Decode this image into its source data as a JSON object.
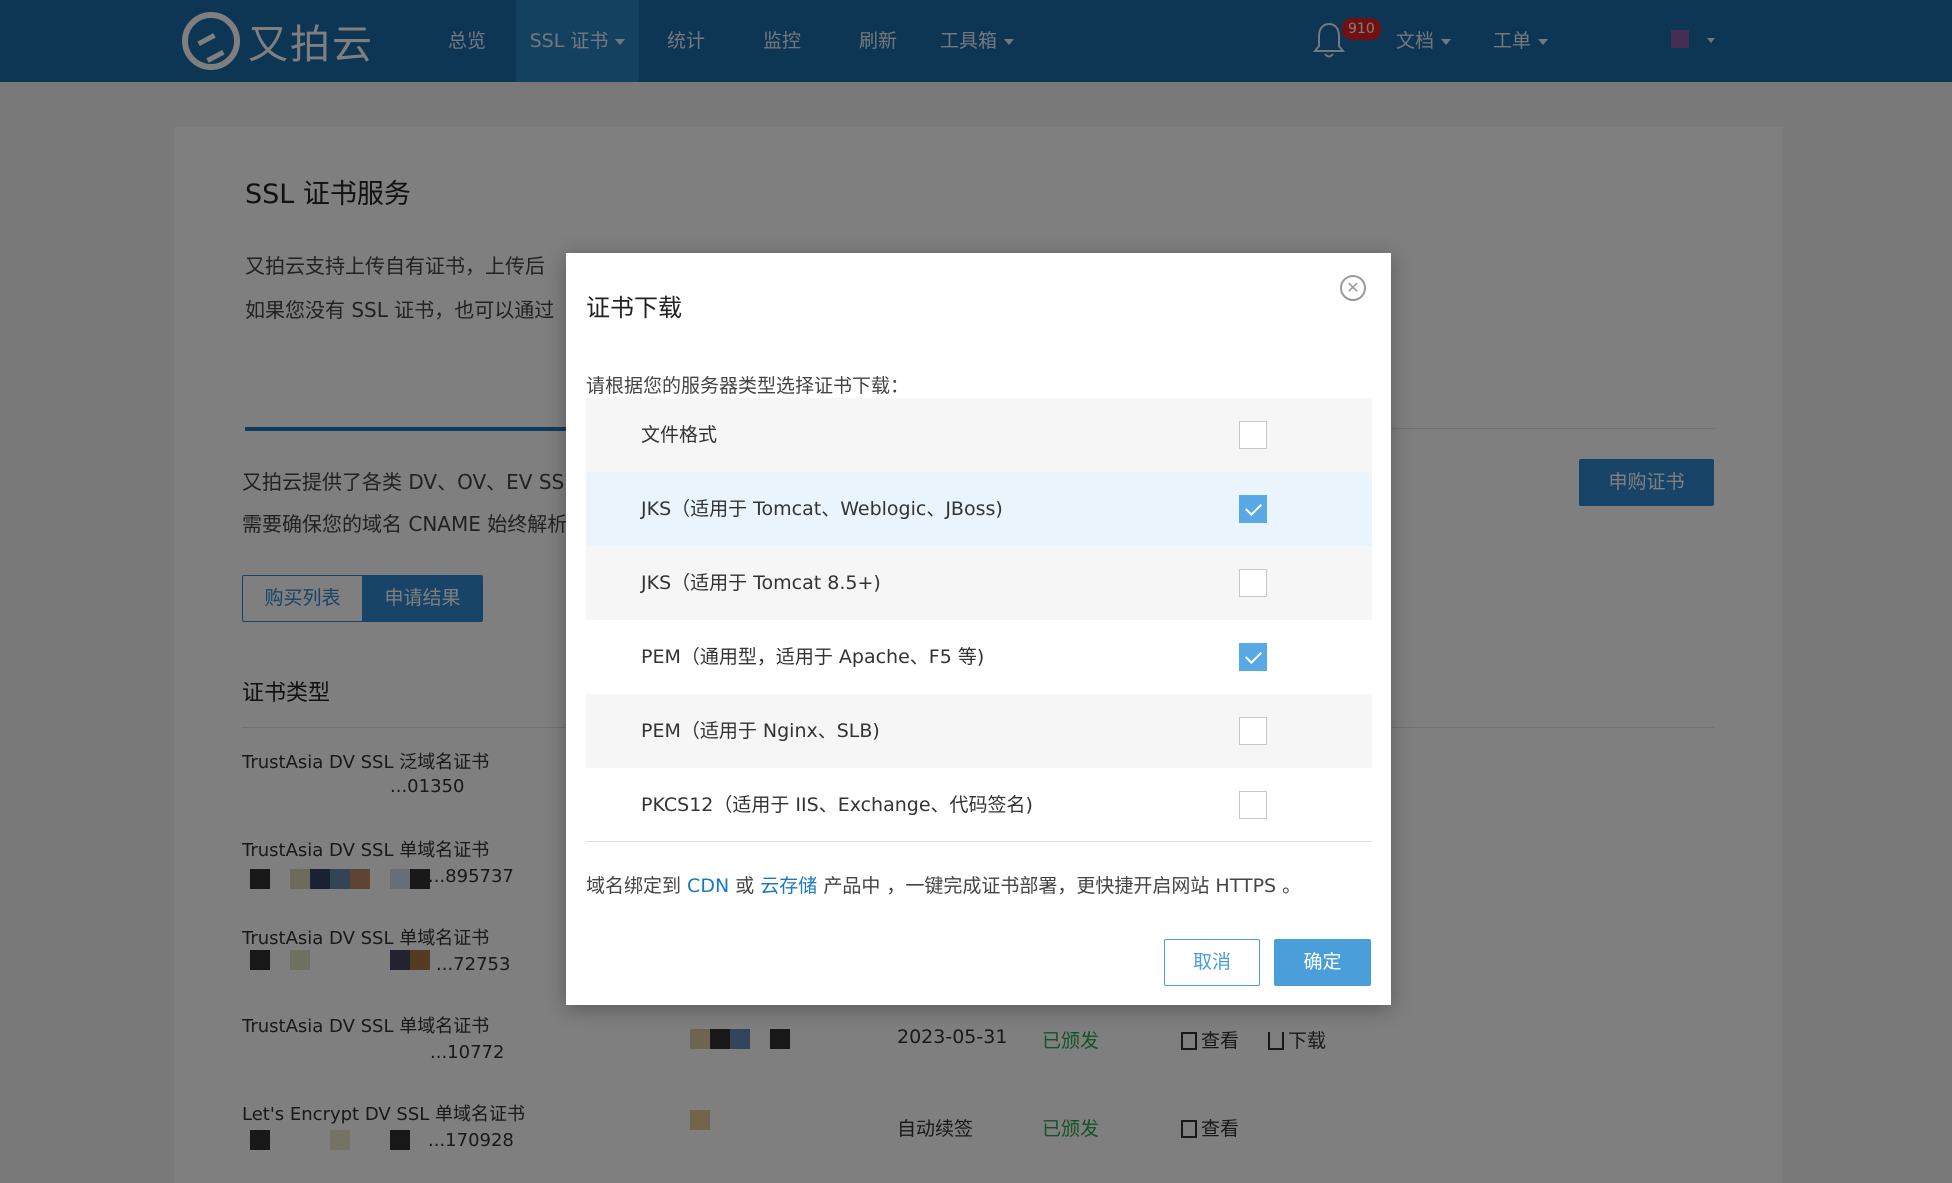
{
  "brand": {
    "name": "又拍云"
  },
  "nav": {
    "items": [
      {
        "label": "总览"
      },
      {
        "label": "SSL 证书"
      },
      {
        "label": "统计"
      },
      {
        "label": "监控"
      },
      {
        "label": "刷新"
      },
      {
        "label": "工具箱"
      }
    ],
    "notifications": "910",
    "docs": "文档",
    "tickets": "工单"
  },
  "page": {
    "title": "SSL 证书服务",
    "desc1": "又拍云支持上传自有证书，上传后",
    "desc2": "如果您没有 SSL 证书，也可以通过",
    "section_desc1": "又拍云提供了各类 DV、OV、EV SSL",
    "section_desc2": "需要确保您的域名 CNAME 始终解析",
    "buy_button": "申购证书",
    "segment_list": "购买列表",
    "segment_result": "申请结果",
    "cert_type_header": "证书类型"
  },
  "colors": {
    "nav": "#1a6aa8",
    "accent": "#2f89cf",
    "modal_button": "#4a9ed9",
    "issued": "#2aa44a"
  },
  "rows": [
    {
      "name": "TrustAsia DV SSL 泛域名证书",
      "id": "...01350"
    },
    {
      "name": "TrustAsia DV SSL 单域名证书",
      "id": "...895737"
    },
    {
      "name": "TrustAsia DV SSL 单域名证书",
      "id": "...72753"
    },
    {
      "name": "TrustAsia DV SSL 单域名证书",
      "id": "...10772",
      "expire": "2023-05-31",
      "status": "已颁发",
      "view": "查看",
      "download": "下载"
    },
    {
      "name": "Let's Encrypt DV SSL 单域名证书",
      "id": "...170928",
      "expire": "自动续签",
      "status": "已颁发",
      "view": "查看"
    }
  ],
  "modal": {
    "title": "证书下载",
    "instruction": "请根据您的服务器类型选择证书下载：",
    "options": [
      {
        "label": "文件格式",
        "checked": false
      },
      {
        "label": "JKS（适用于 Tomcat、Weblogic、JBoss)",
        "checked": true
      },
      {
        "label": "JKS（适用于 Tomcat 8.5+)",
        "checked": false
      },
      {
        "label": "PEM（通用型，适用于 Apache、F5 等)",
        "checked": true
      },
      {
        "label": "PEM（适用于 Nginx、SLB)",
        "checked": false
      },
      {
        "label": "PKCS12（适用于 IIS、Exchange、代码签名)",
        "checked": false
      }
    ],
    "note_prefix": "域名绑定到 ",
    "note_cdn": "CDN",
    "note_or": " 或 ",
    "note_storage": "云存储",
    "note_suffix": " 产品中 ，一键完成证书部署，更快捷开启网站 HTTPS 。",
    "cancel": "取消",
    "confirm": "确定"
  }
}
